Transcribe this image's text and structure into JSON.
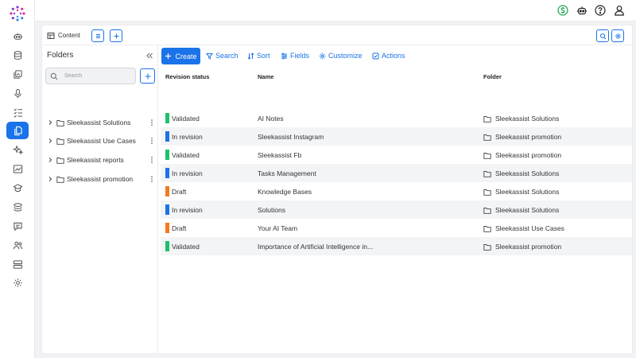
{
  "topbar": {
    "icons": [
      "dollar-circle-icon",
      "robot-icon",
      "help-circle-icon",
      "user-icon"
    ],
    "colors": {
      "dollar": "#1aa34a",
      "default": "#222222"
    }
  },
  "rail": {
    "items": [
      "bot-icon",
      "database-icon",
      "media-icon",
      "microphone-icon",
      "checklist-icon",
      "documents-icon",
      "sparkle-icon",
      "analytics-icon",
      "school-icon",
      "layers-icon",
      "chat-icon",
      "users-icon",
      "server-icon",
      "settings-icon"
    ],
    "active": "documents-icon"
  },
  "tabs": {
    "content_label": "Content"
  },
  "folders": {
    "title": "Folders",
    "search_placeholder": "Search",
    "items": [
      {
        "label": "Sleekassist Solutions"
      },
      {
        "label": "Sleekassist Use Cases"
      },
      {
        "label": "Sleekassist reports"
      },
      {
        "label": "Sleekassist promotion"
      }
    ]
  },
  "toolbar": {
    "create": "Create",
    "search": "Search",
    "sort": "Sort",
    "fields": "Fields",
    "customize": "Customize",
    "actions": "Actions"
  },
  "table": {
    "headers": {
      "status": "Revision status",
      "name": "Name",
      "folder": "Folder"
    },
    "rows": [
      {
        "status": "Validated",
        "status_color": "#1fc06a",
        "name": "AI Notes",
        "folder": "Sleekassist Solutions"
      },
      {
        "status": "In revision",
        "status_color": "#1a73e8",
        "name": "Sleekassist Instagram",
        "folder": "Sleekassist promotion"
      },
      {
        "status": "Validated",
        "status_color": "#1fc06a",
        "name": "Sleekassist Fb",
        "folder": "Sleekassist promotion"
      },
      {
        "status": "In revision",
        "status_color": "#1a73e8",
        "name": "Tasks Management",
        "folder": "Sleekassist Solutions"
      },
      {
        "status": "Draft",
        "status_color": "#f47a1f",
        "name": "Knowledge Bases",
        "folder": "Sleekassist Solutions"
      },
      {
        "status": "In revision",
        "status_color": "#1a73e8",
        "name": "Solutions",
        "folder": "Sleekassist Solutions"
      },
      {
        "status": "Draft",
        "status_color": "#f47a1f",
        "name": "Your AI Team",
        "folder": "Sleekassist Use Cases"
      },
      {
        "status": "Validated",
        "status_color": "#1fc06a",
        "name": "Importance of Artificial Intelligence in...",
        "folder": "Sleekassist promotion"
      }
    ]
  },
  "colors": {
    "accent": "#1a73e8",
    "row_alt": "#f3f4f6"
  }
}
